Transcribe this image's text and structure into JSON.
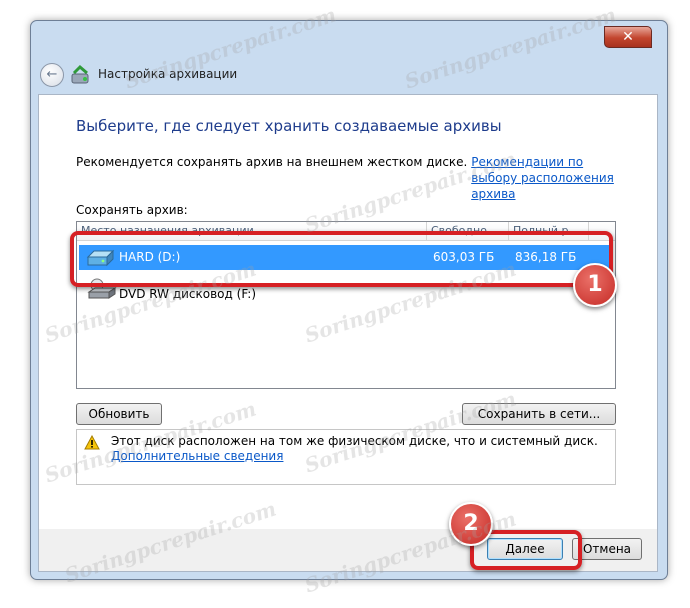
{
  "window": {
    "title": "Настройка архивации",
    "close_label": "✕"
  },
  "content": {
    "heading": "Выберите, где следует хранить создаваемые архивы",
    "recommend_text": "Рекомендуется сохранять архив на внешнем жестком диске.",
    "recommend_link": "Рекомендации по выбору расположения архива",
    "save_label": "Сохранять архив:"
  },
  "list": {
    "columns": [
      "Место назначения архивации",
      "Свободно",
      "Полный р..."
    ],
    "rows": [
      {
        "name": "HARD (D:)",
        "free": "603,03 ГБ",
        "total": "836,18 ГБ",
        "selected": true
      },
      {
        "name": "DVD RW дисковод (F:)",
        "free": "",
        "total": "",
        "selected": false
      }
    ]
  },
  "buttons": {
    "refresh": "Обновить",
    "save_network": "Сохранить в сети...",
    "next": "Далее",
    "cancel": "Отмена"
  },
  "warning": {
    "text": "Этот диск расположен на том же физическом диске, что и системный диск.",
    "link": "Дополнительные сведения"
  },
  "annotations": {
    "badge1": "1",
    "badge2": "2",
    "highlight_color": "#d62024"
  },
  "watermark": "Soringpcrepair.com"
}
